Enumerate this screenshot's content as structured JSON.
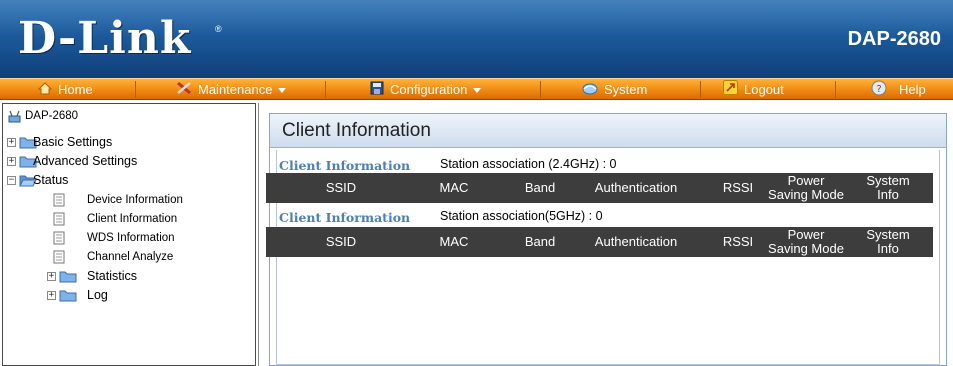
{
  "header": {
    "brand": "D-Link",
    "model": "DAP-2680"
  },
  "menu": {
    "home": "Home",
    "maintenance": "Maintenance",
    "configuration": "Configuration",
    "system": "System",
    "logout": "Logout",
    "help": "Help"
  },
  "tree": {
    "root": "DAP-2680",
    "basic_settings": "Basic Settings",
    "advanced_settings": "Advanced Settings",
    "status": "Status",
    "device_information": "Device Information",
    "client_information": "Client Information",
    "wds_information": "WDS Information",
    "channel_analyze": "Channel Analyze",
    "statistics": "Statistics",
    "log": "Log"
  },
  "panel": {
    "title": "Client Information",
    "section1_label": "Client Information",
    "section1_station": "Station association (2.4GHz) :  0",
    "section2_label": "Client Information",
    "section2_station": "Station association(5GHz) :  0",
    "columns": {
      "ssid": "SSID",
      "mac": "MAC",
      "band": "Band",
      "authentication": "Authentication",
      "rssi": "RSSI",
      "power_line1": "Power",
      "power_line2": "Saving Mode",
      "system_line1": "System",
      "system_line2": "Info"
    }
  },
  "colors": {
    "header_blue": "#1c5a9c",
    "menu_orange": "#f08a12",
    "table_head": "#3d3d3d",
    "section_label": "#4a7fb8"
  }
}
